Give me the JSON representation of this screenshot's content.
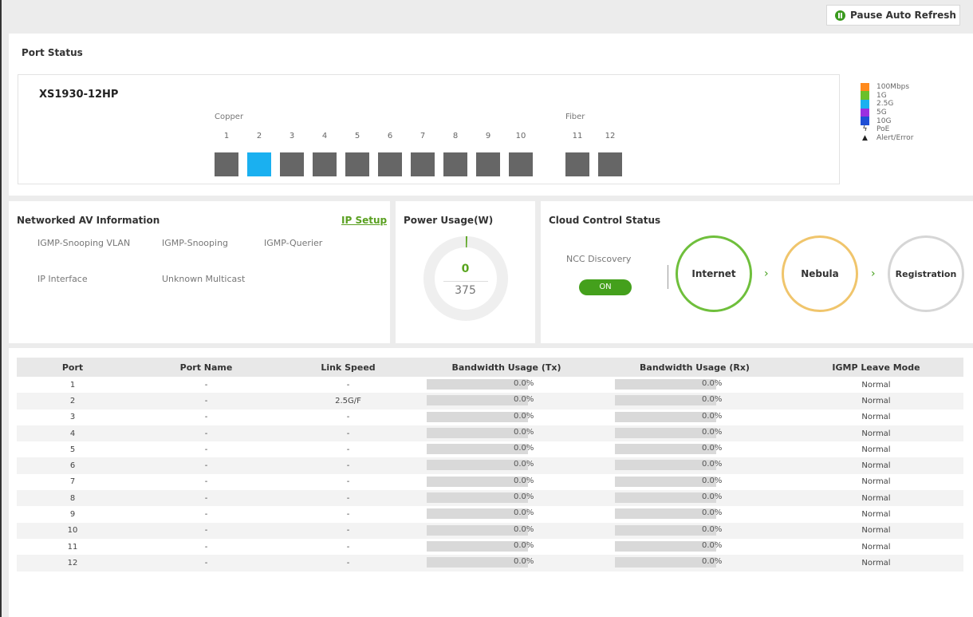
{
  "toolbar": {
    "pause_label": "Pause Auto Refresh"
  },
  "port_status": {
    "title": "Port Status",
    "model": "XS1930-12HP",
    "copper_label": "Copper",
    "fiber_label": "Fiber",
    "ports": [
      {
        "num": "1",
        "speed": "off"
      },
      {
        "num": "2",
        "speed": "2.5G"
      },
      {
        "num": "3",
        "speed": "off"
      },
      {
        "num": "4",
        "speed": "off"
      },
      {
        "num": "5",
        "speed": "off"
      },
      {
        "num": "6",
        "speed": "off"
      },
      {
        "num": "7",
        "speed": "off"
      },
      {
        "num": "8",
        "speed": "off"
      },
      {
        "num": "9",
        "speed": "off"
      },
      {
        "num": "10",
        "speed": "off"
      },
      {
        "num": "11",
        "speed": "off"
      },
      {
        "num": "12",
        "speed": "off"
      }
    ],
    "legend": [
      {
        "label": "100Mbps",
        "color": "#ff8a1c"
      },
      {
        "label": "1G",
        "color": "#6ac02a"
      },
      {
        "label": "2.5G",
        "color": "#1ab0f0"
      },
      {
        "label": "5G",
        "color": "#9b2fe0"
      },
      {
        "label": "10G",
        "color": "#1f4fd6"
      },
      {
        "label": "PoE",
        "icon": "lightning-icon",
        "glyph": "ϟ"
      },
      {
        "label": "Alert/Error",
        "icon": "warning-icon",
        "glyph": "▲"
      }
    ]
  },
  "av_info": {
    "title": "Networked AV Information",
    "ip_setup": "IP Setup",
    "igmp_snooping_vlan": "IGMP-Snooping VLAN",
    "igmp_snooping": "IGMP-Snooping",
    "igmp_querier": "IGMP-Querier",
    "ip_interface": "IP Interface",
    "unknown_multicast": "Unknown Multicast"
  },
  "power": {
    "title": "Power Usage(W)",
    "value": "0",
    "max": "375",
    "usage_fraction": 0,
    "accent": "#59a51e"
  },
  "cloud": {
    "title": "Cloud Control Status",
    "ncc_label": "NCC Discovery",
    "ncc_toggle": "ON",
    "internet": "Internet",
    "nebula": "Nebula",
    "registration": "Registration",
    "chevron": "›"
  },
  "table": {
    "headers": [
      "Port",
      "Port Name",
      "Link Speed",
      "Bandwidth Usage (Tx)",
      "Bandwidth Usage (Rx)",
      "IGMP Leave Mode"
    ],
    "rows": [
      {
        "port": "1",
        "name": "-",
        "speed": "-",
        "tx": "0.0%",
        "tx_frac": 0,
        "rx": "0.0%",
        "rx_frac": 0,
        "leave": "Normal"
      },
      {
        "port": "2",
        "name": "-",
        "speed": "2.5G/F",
        "tx": "0.0%",
        "tx_frac": 0,
        "rx": "0.0%",
        "rx_frac": 0,
        "leave": "Normal"
      },
      {
        "port": "3",
        "name": "-",
        "speed": "-",
        "tx": "0.0%",
        "tx_frac": 0,
        "rx": "0.0%",
        "rx_frac": 0,
        "leave": "Normal"
      },
      {
        "port": "4",
        "name": "-",
        "speed": "-",
        "tx": "0.0%",
        "tx_frac": 0,
        "rx": "0.0%",
        "rx_frac": 0,
        "leave": "Normal"
      },
      {
        "port": "5",
        "name": "-",
        "speed": "-",
        "tx": "0.0%",
        "tx_frac": 0,
        "rx": "0.0%",
        "rx_frac": 0,
        "leave": "Normal"
      },
      {
        "port": "6",
        "name": "-",
        "speed": "-",
        "tx": "0.0%",
        "tx_frac": 0,
        "rx": "0.0%",
        "rx_frac": 0,
        "leave": "Normal"
      },
      {
        "port": "7",
        "name": "-",
        "speed": "-",
        "tx": "0.0%",
        "tx_frac": 0,
        "rx": "0.0%",
        "rx_frac": 0,
        "leave": "Normal"
      },
      {
        "port": "8",
        "name": "-",
        "speed": "-",
        "tx": "0.0%",
        "tx_frac": 0,
        "rx": "0.0%",
        "rx_frac": 0,
        "leave": "Normal"
      },
      {
        "port": "9",
        "name": "-",
        "speed": "-",
        "tx": "0.0%",
        "tx_frac": 0,
        "rx": "0.0%",
        "rx_frac": 0,
        "leave": "Normal"
      },
      {
        "port": "10",
        "name": "-",
        "speed": "-",
        "tx": "0.0%",
        "tx_frac": 0,
        "rx": "0.0%",
        "rx_frac": 0,
        "leave": "Normal"
      },
      {
        "port": "11",
        "name": "-",
        "speed": "-",
        "tx": "0.0%",
        "tx_frac": 0,
        "rx": "0.0%",
        "rx_frac": 0,
        "leave": "Normal"
      },
      {
        "port": "12",
        "name": "-",
        "speed": "-",
        "tx": "0.0%",
        "tx_frac": 0,
        "rx": "0.0%",
        "rx_frac": 0,
        "leave": "Normal"
      }
    ]
  }
}
